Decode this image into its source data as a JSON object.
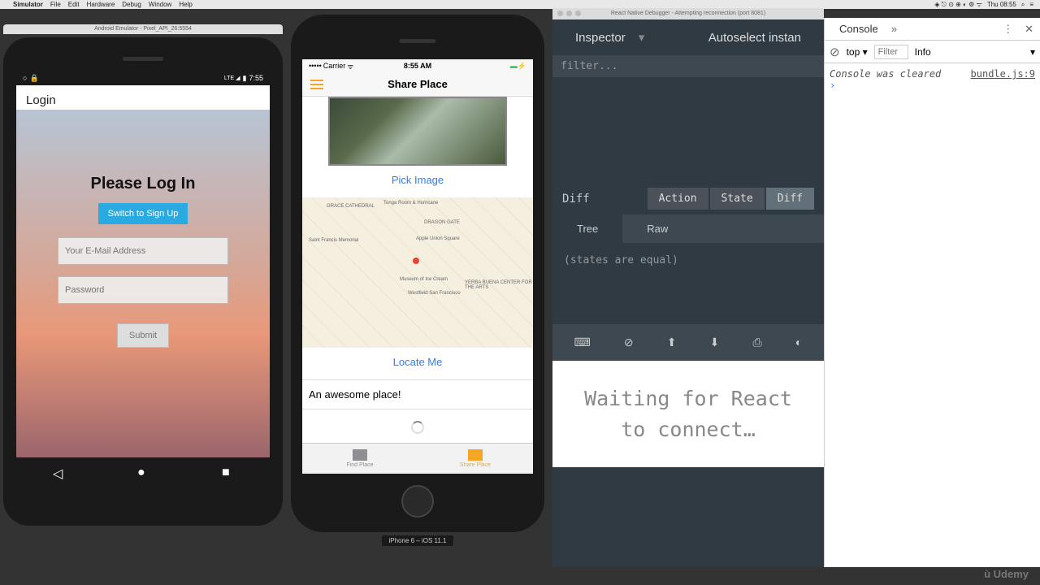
{
  "macmenu": {
    "app": "Simulator",
    "items": [
      "File",
      "Edit",
      "Hardware",
      "Debug",
      "Window",
      "Help"
    ],
    "clock": "Thu 08:55"
  },
  "android": {
    "window_title": "Android Emulator - Pixel_API_26:5554",
    "time": "7:55",
    "login_title": "Login",
    "heading": "Please Log In",
    "switch_btn": "Switch to Sign Up",
    "email_ph": "Your E-Mail Address",
    "password_ph": "Password",
    "submit": "Submit"
  },
  "iphone": {
    "carrier": "Carrier",
    "time": "8:55 AM",
    "nav_title": "Share Place",
    "pick_image": "Pick Image",
    "locate_me": "Locate Me",
    "place_text": "An awesome place!",
    "tab1": "Find Place",
    "tab2": "Share Place",
    "device_label": "iPhone 6 – iOS 11.1"
  },
  "rn": {
    "window_title": "React Native Debugger - Attempting reconnection (port 8081)",
    "inspector": "Inspector",
    "autoselect": "Autoselect instan",
    "filter_ph": "filter...",
    "diff_label": "Diff",
    "btn_action": "Action",
    "btn_state": "State",
    "btn_diff": "Diff",
    "tree": "Tree",
    "raw": "Raw",
    "states_equal": "(states are equal)",
    "waiting": "Waiting for React to connect…"
  },
  "devtools": {
    "console": "Console",
    "top": "top",
    "filter": "Filter",
    "level": "Info",
    "cleared": "Console was cleared",
    "bundle": "bundle.js:9"
  },
  "brand": "Udemy"
}
